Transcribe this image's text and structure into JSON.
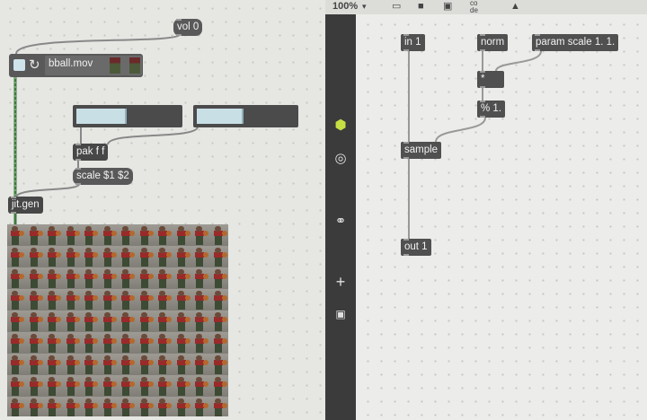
{
  "patcher": {
    "objects": {
      "vol": "vol 0",
      "movie": "bball.mov",
      "pak": "pak f f",
      "scale": "scale $1 $2",
      "jitgen": "jit.gen"
    }
  },
  "gen_editor": {
    "zoom": "100%",
    "objects": {
      "in1": "in 1",
      "norm": "norm",
      "param": "param scale 1. 1.",
      "mult": "*",
      "mod": "% 1.",
      "sample": "sample",
      "out1": "out 1"
    },
    "toolbar_icons": [
      "panel-icon",
      "comment-icon",
      "fullscreen-icon",
      "codebox-icon",
      "paint-bucket-icon"
    ],
    "sidebar_icons": [
      "cube-icon",
      "target-icon",
      "paperclip-icon",
      "plus-icon",
      "glasses-icon"
    ]
  }
}
